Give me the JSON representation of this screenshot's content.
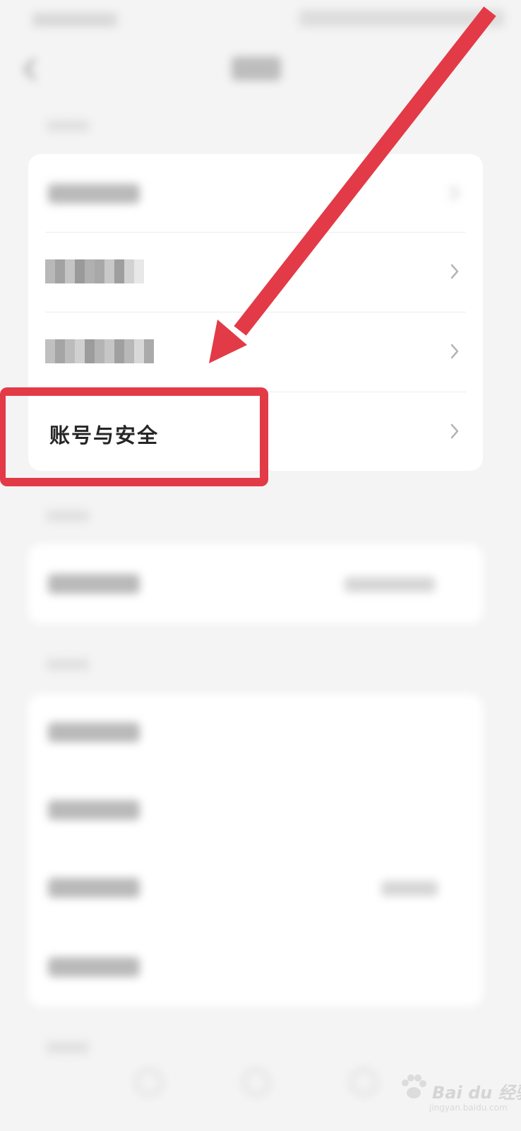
{
  "settings": {
    "account_security_label": "账号与安全"
  },
  "icons": {
    "back": "chevron-left-icon",
    "row_chevron": "chevron-right-icon"
  },
  "annotation": {
    "color": "#e33a47"
  },
  "watermark": {
    "logo_text": "Bai du 经验",
    "url": "jingyan.baidu.com"
  }
}
